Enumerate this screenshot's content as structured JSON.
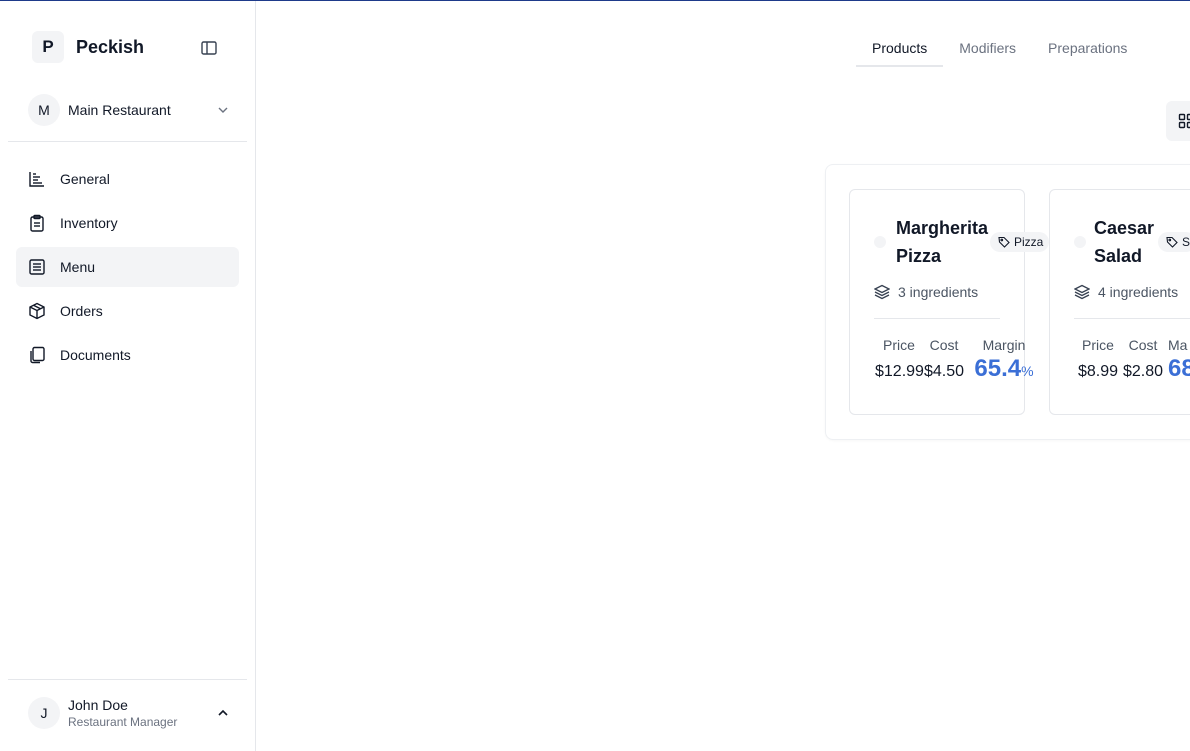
{
  "brand": {
    "initial": "P",
    "name": "Peckish"
  },
  "restaurant": {
    "initial": "M",
    "name": "Main Restaurant"
  },
  "nav": [
    {
      "label": "General",
      "icon": "chart-icon"
    },
    {
      "label": "Inventory",
      "icon": "clipboard-icon"
    },
    {
      "label": "Menu",
      "icon": "menu-list-icon",
      "active": true
    },
    {
      "label": "Orders",
      "icon": "package-icon"
    },
    {
      "label": "Documents",
      "icon": "documents-icon"
    }
  ],
  "user": {
    "initial": "J",
    "name": "John Doe",
    "role": "Restaurant Manager"
  },
  "tabs": [
    {
      "label": "Products",
      "active": true
    },
    {
      "label": "Modifiers"
    },
    {
      "label": "Preparations"
    }
  ],
  "products": [
    {
      "name": "Margherita Pizza",
      "tag": "Pizza",
      "ingredients": "3 ingredients",
      "price_label": "Price",
      "price": "$12.99",
      "cost_label": "Cost",
      "cost": "$4.50",
      "margin_label": "Margin",
      "margin": "65.4",
      "margin_unit": "%"
    },
    {
      "name": "Caesar Salad",
      "tag": "S",
      "ingredients": "4 ingredients",
      "price_label": "Price",
      "price": "$8.99",
      "cost_label": "Cost",
      "cost": "$2.80",
      "margin_label": "Ma",
      "margin": "68",
      "margin_unit": ""
    }
  ],
  "colors": {
    "accent": "#3b6fd6",
    "active_bg": "#f3f4f6",
    "border": "#e5e7eb"
  }
}
